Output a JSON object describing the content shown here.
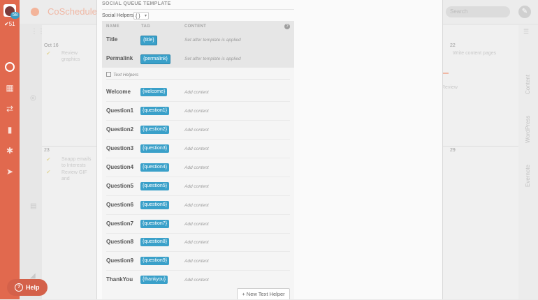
{
  "app": {
    "name": "CoSchedule",
    "search_placeholder": "Search"
  },
  "user": {
    "notifications": "58",
    "checks": "51"
  },
  "calendar": {
    "dates": [
      "Oct 16",
      "22",
      "23",
      "29"
    ],
    "tasks": [
      "Review graphics",
      "Write content pages",
      "Snapp emails to Interests",
      "Review GIF and",
      "Review"
    ],
    "rail": [
      "Content",
      "WordPress",
      "Evernote"
    ]
  },
  "modal": {
    "title": "SOCIAL QUEUE TEMPLATE",
    "helpers_label": "Social Helpers",
    "helpers_value": "{ }",
    "columns": {
      "name": "NAME",
      "tag": "TAG",
      "content": "CONTENT"
    },
    "fixed_rows": [
      {
        "name": "Title",
        "tag": "{title}",
        "content": "Set after template is applied"
      },
      {
        "name": "Permalink",
        "tag": "{permalink}",
        "content": "Set after template is applied"
      }
    ],
    "text_helpers_label": "Text Helpers",
    "helper_rows": [
      {
        "name": "Welcome",
        "tag": "{welcome}",
        "content": "Add content"
      },
      {
        "name": "Question1",
        "tag": "{question1}",
        "content": "Add content"
      },
      {
        "name": "Question2",
        "tag": "{question2}",
        "content": "Add content"
      },
      {
        "name": "Question3",
        "tag": "{question3}",
        "content": "Add content"
      },
      {
        "name": "Question4",
        "tag": "{question4}",
        "content": "Add content"
      },
      {
        "name": "Question5",
        "tag": "{question5}",
        "content": "Add content"
      },
      {
        "name": "Question6",
        "tag": "{question6}",
        "content": "Add content"
      },
      {
        "name": "Question7",
        "tag": "{question7}",
        "content": "Add content"
      },
      {
        "name": "Question8",
        "tag": "{question8}",
        "content": "Add content"
      },
      {
        "name": "Question9",
        "tag": "{question9}",
        "content": "Add content"
      },
      {
        "name": "ThankYou",
        "tag": "{thankyou}",
        "content": "Add content"
      }
    ],
    "new_helper_label": "+ New Text Helper"
  },
  "help_label": "Help",
  "colors": {
    "brand": "#e1694e",
    "tag": "#3aa0c9"
  }
}
